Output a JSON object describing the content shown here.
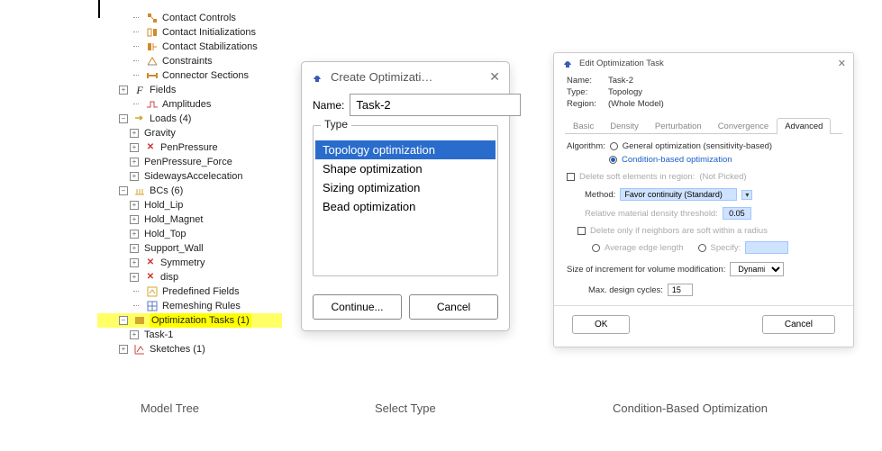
{
  "captions": {
    "tree": "Model Tree",
    "create": "Select Type",
    "edit": "Condition-Based Optimization"
  },
  "tree": {
    "items": {
      "contact_controls": "Contact Controls",
      "contact_init": "Contact Initializations",
      "contact_stab": "Contact Stabilizations",
      "constraints": "Constraints",
      "connector_sections": "Connector Sections",
      "fields": "Fields",
      "amplitudes": "Amplitudes",
      "loads": "Loads (4)",
      "gravity": "Gravity",
      "penpressure": "PenPressure",
      "penpressure_force": "PenPressure_Force",
      "side_accel": "SidewaysAccelecation",
      "bcs": "BCs (6)",
      "hold_lip": "Hold_Lip",
      "hold_magnet": "Hold_Magnet",
      "hold_top": "Hold_Top",
      "support_wall": "Support_Wall",
      "symmetry": "Symmetry",
      "disp": "disp",
      "predef_fields": "Predefined Fields",
      "remesh_rules": "Remeshing Rules",
      "opt_tasks": "Optimization Tasks (1)",
      "task1": "Task-1",
      "sketches": "Sketches (1)"
    }
  },
  "create_dialog": {
    "title": "Create Optimizati…",
    "name_label": "Name:",
    "name_value": "Task-2",
    "type_label": "Type",
    "types": [
      "Topology optimization",
      "Shape optimization",
      "Sizing optimization",
      "Bead optimization"
    ],
    "continue": "Continue...",
    "cancel": "Cancel"
  },
  "edit_dialog": {
    "title": "Edit Optimization Task",
    "meta": {
      "name_k": "Name:",
      "name_v": "Task-2",
      "type_k": "Type:",
      "type_v": "Topology",
      "region_k": "Region:",
      "region_v": "(Whole Model)"
    },
    "tabs": {
      "basic": "Basic",
      "density": "Density",
      "perturb": "Perturbation",
      "convergence": "Convergence",
      "advanced": "Advanced"
    },
    "adv": {
      "algo_label": "Algorithm:",
      "algo_general": "General optimization (sensitivity-based)",
      "algo_cond": "Condition-based optimization",
      "del_soft": "Delete soft elements in region:",
      "not_picked": "(Not Picked)",
      "method_label": "Method:",
      "method_value": "Favor continuity (Standard)",
      "rel_dens_label": "Relative material density threshold:",
      "rel_dens_value": "0.05",
      "del_neigh": "Delete only if neighbors are soft within a radius",
      "avg_edge": "Average edge length",
      "specify": "Specify:",
      "incr_label": "Size of increment for volume modification:",
      "incr_value": "Dynamic",
      "max_cycles_label": "Max. design cycles:",
      "max_cycles_value": "15",
      "ok": "OK",
      "cancel": "Cancel"
    }
  }
}
